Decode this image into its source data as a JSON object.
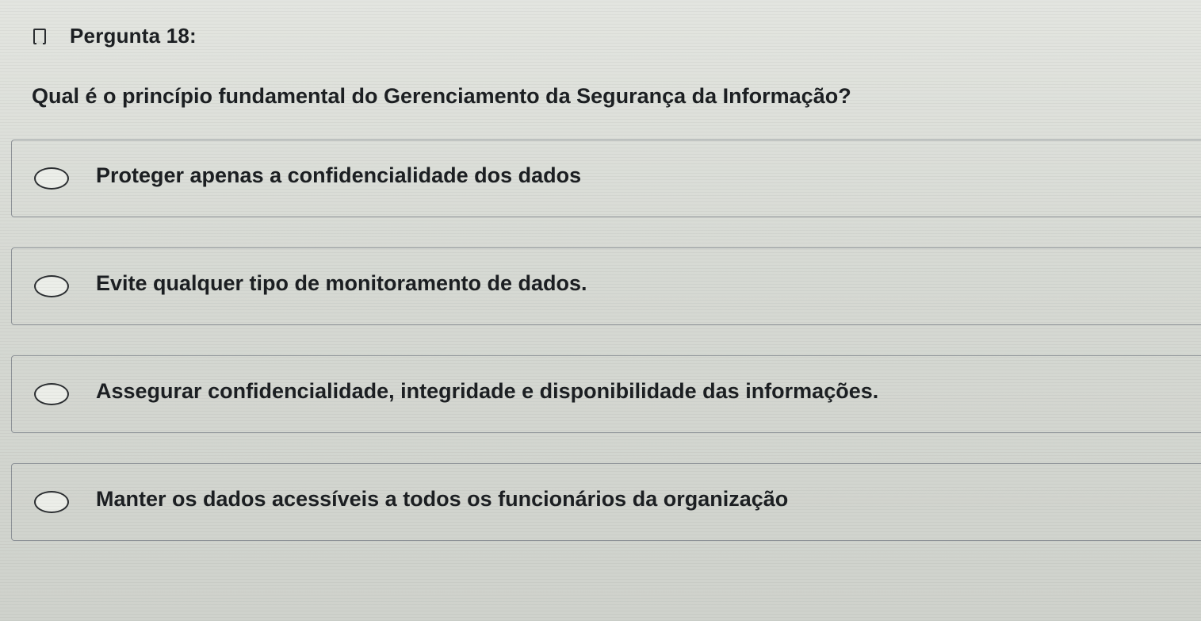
{
  "question": {
    "number_label": "Pergunta 18:",
    "text": "Qual é o princípio fundamental do Gerenciamento da Segurança da Informação?"
  },
  "options": [
    {
      "label": "Proteger apenas a confidencialidade dos dados"
    },
    {
      "label": "Evite qualquer tipo de monitoramento de dados."
    },
    {
      "label": "Assegurar confidencialidade, integridade e disponibilidade das informações."
    },
    {
      "label": "Manter os dados acessíveis a todos os funcionários da organização"
    }
  ]
}
